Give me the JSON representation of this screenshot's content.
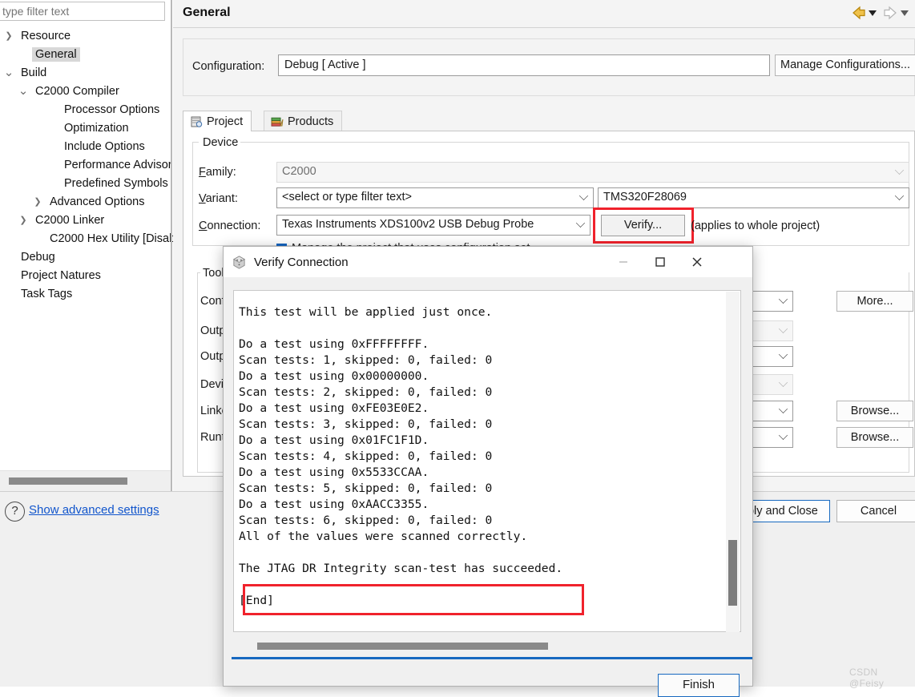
{
  "left_panel": {
    "filter_placeholder": "type filter text",
    "tree": [
      {
        "label": "Resource",
        "indent": 0,
        "twisty": "collapsed",
        "selected": false
      },
      {
        "label": "General",
        "indent": 1,
        "twisty": "none",
        "selected": true
      },
      {
        "label": "Build",
        "indent": 0,
        "twisty": "expanded",
        "selected": false
      },
      {
        "label": "C2000 Compiler",
        "indent": 1,
        "twisty": "expanded",
        "selected": false
      },
      {
        "label": "Processor Options",
        "indent": 3,
        "twisty": "none",
        "selected": false
      },
      {
        "label": "Optimization",
        "indent": 3,
        "twisty": "none",
        "selected": false
      },
      {
        "label": "Include Options",
        "indent": 3,
        "twisty": "none",
        "selected": false
      },
      {
        "label": "Performance Advisor",
        "indent": 3,
        "twisty": "none",
        "selected": false
      },
      {
        "label": "Predefined Symbols",
        "indent": 3,
        "twisty": "none",
        "selected": false
      },
      {
        "label": "Advanced Options",
        "indent": 2,
        "twisty": "collapsed",
        "selected": false
      },
      {
        "label": "C2000 Linker",
        "indent": 1,
        "twisty": "collapsed",
        "selected": false
      },
      {
        "label": "C2000 Hex Utility  [Disab",
        "indent": 2,
        "twisty": "none",
        "selected": false
      },
      {
        "label": "Debug",
        "indent": 0,
        "twisty": "none",
        "selected": false
      },
      {
        "label": "Project Natures",
        "indent": 0,
        "twisty": "none",
        "selected": false
      },
      {
        "label": "Task Tags",
        "indent": 0,
        "twisty": "none",
        "selected": false
      }
    ]
  },
  "header": {
    "title": "General",
    "back_label": "Back",
    "forward_label": "Forward"
  },
  "configuration": {
    "label": "Configuration:",
    "value": "Debug  [ Active ]",
    "manage_label": "Manage Configurations..."
  },
  "tabs": [
    {
      "label": "Project",
      "icon": "project-icon",
      "active": true
    },
    {
      "label": "Products",
      "icon": "products-icon",
      "active": false
    }
  ],
  "device": {
    "legend": "Device",
    "family_label": "Family:",
    "family_value": "C2000",
    "variant_label": "Variant:",
    "variant_filter_value": "<select or type filter text>",
    "variant_value": "TMS320F28069",
    "connection_label": "Connection:",
    "connection_value": "Texas Instruments XDS100v2 USB Debug Probe",
    "verify_label": "Verify...",
    "verify_note": "(applies to whole project)",
    "checkbox_text": "Manage the project that uses configuration set",
    "checkbox_checked": true,
    "highlight_color": "#f0222c"
  },
  "settings_group": {
    "legend": "Tool Settings",
    "rows": [
      {
        "label": "Configuration",
        "button": "More..."
      },
      {
        "label": "Output type",
        "button": ""
      },
      {
        "label": "Output format",
        "button": ""
      },
      {
        "label": "Device",
        "button": ""
      },
      {
        "label": "Linker command",
        "button": "Browse..."
      },
      {
        "label": "Runtime",
        "button": "Browse..."
      }
    ]
  },
  "bottom_bar": {
    "help_glyph": "?",
    "advanced_link": "Show advanced settings",
    "apply_close_label": "Apply and Close",
    "cancel_label": "Cancel",
    "watermark": "CSDN @Feisy"
  },
  "dialog": {
    "title": "Verify Connection",
    "icon": "ti-cube-icon",
    "minimize_label": "Minimize",
    "maximize_label": "Maximize",
    "close_label": "Close",
    "finish_label": "Finish",
    "highlight_color": "#f0222c",
    "log_text": "This test will be applied just once.\n\nDo a test using 0xFFFFFFFF.\nScan tests: 1, skipped: 0, failed: 0\nDo a test using 0x00000000.\nScan tests: 2, skipped: 0, failed: 0\nDo a test using 0xFE03E0E2.\nScan tests: 3, skipped: 0, failed: 0\nDo a test using 0x01FC1F1D.\nScan tests: 4, skipped: 0, failed: 0\nDo a test using 0x5533CCAA.\nScan tests: 5, skipped: 0, failed: 0\nDo a test using 0xAACC3355.\nScan tests: 6, skipped: 0, failed: 0\nAll of the values were scanned correctly.\n\nThe JTAG DR Integrity scan-test has succeeded.\n\n[End]",
    "highlighted_line": "The JTAG DR Integrity scan-test has succeeded."
  }
}
